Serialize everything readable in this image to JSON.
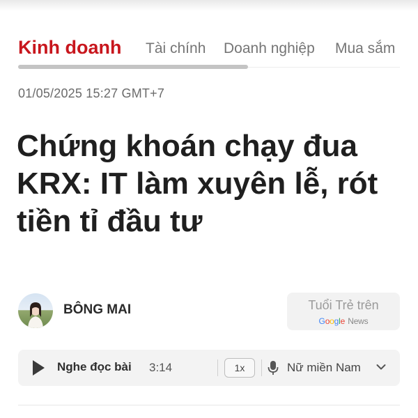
{
  "tabs": [
    {
      "label": "Kinh doanh",
      "active": true
    },
    {
      "label": "Tài chính",
      "active": false
    },
    {
      "label": "Doanh nghiệp",
      "active": false
    },
    {
      "label": "Mua sắm",
      "active": false
    }
  ],
  "article": {
    "timestamp": "01/05/2025 15:27 GMT+7",
    "title": "Chứng khoán chạy đua KRX: IT làm xuyên lễ, rót tiền tỉ đầu tư"
  },
  "author": {
    "name": "BÔNG MAI",
    "avatar_icon": "author-avatar"
  },
  "source_badge": {
    "label": "Tuổi Trẻ trên",
    "google_news": {
      "g": "G",
      "o1": "o",
      "o2": "o",
      "g2": "g",
      "l": "l",
      "e": "e",
      "news": "News"
    }
  },
  "player": {
    "listen_label": "Nghe đọc bài",
    "duration": "3:14",
    "speed": "1x",
    "voice": "Nữ miền Nam",
    "icons": [
      "play-icon",
      "mic-icon",
      "chevron-down-icon"
    ]
  },
  "colors": {
    "accent": "#c8161d",
    "tab_inactive": "#757575",
    "player_bg": "#f3f3f3"
  }
}
